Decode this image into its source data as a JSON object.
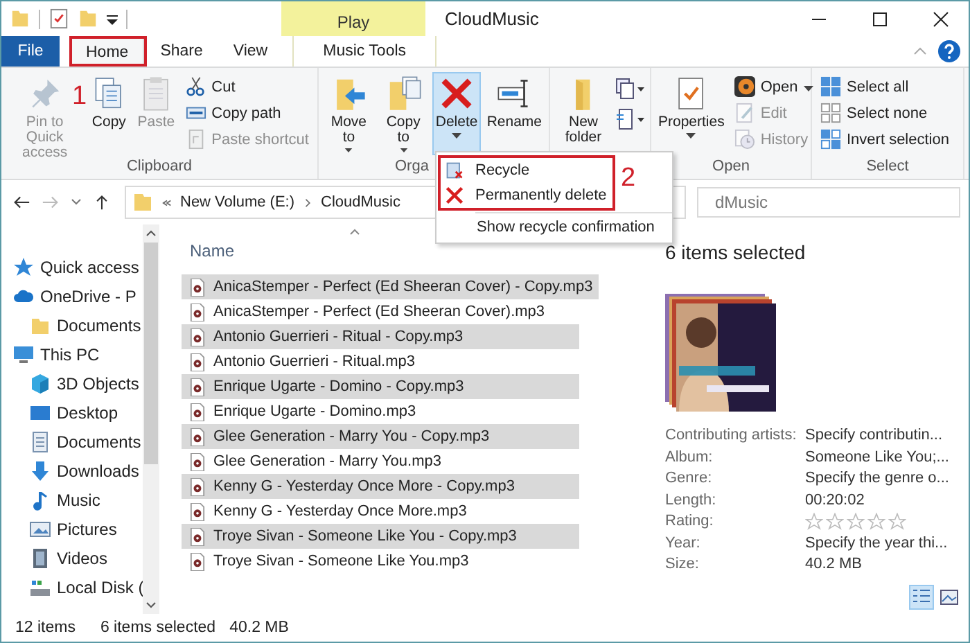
{
  "window": {
    "title": "CloudMusic",
    "contextual_group": "Play"
  },
  "tabs": [
    {
      "label": "File",
      "kind": "file",
      "selected": false
    },
    {
      "label": "Home",
      "kind": "normal",
      "selected": true
    },
    {
      "label": "Share",
      "kind": "normal",
      "selected": false
    },
    {
      "label": "View",
      "kind": "normal",
      "selected": false
    },
    {
      "label": "Music Tools",
      "kind": "contextual",
      "selected": false
    }
  ],
  "ribbon": {
    "groups": [
      {
        "label": "Clipboard",
        "items": [
          {
            "label": "Pin to Quick access",
            "disabled": true
          },
          {
            "label": "Copy",
            "disabled": false
          },
          {
            "label": "Paste",
            "disabled": true
          },
          {
            "label": "Cut",
            "disabled": false
          },
          {
            "label": "Copy path",
            "disabled": false
          },
          {
            "label": "Paste shortcut",
            "disabled": true
          }
        ]
      },
      {
        "label": "Orga",
        "items": [
          {
            "label": "Move to",
            "dropdown": true,
            "pressed": false
          },
          {
            "label": "Copy to",
            "dropdown": true,
            "pressed": false
          },
          {
            "label": "Delete",
            "dropdown": true,
            "pressed": true
          },
          {
            "label": "Rename",
            "pressed": false
          }
        ]
      },
      {
        "items": [
          {
            "label": "New folder",
            "disabled": false
          }
        ]
      },
      {
        "label": "Open",
        "items": [
          {
            "label": "Properties",
            "dropdown": true,
            "disabled": false
          },
          {
            "label": "Open",
            "dropdown": true,
            "disabled": false
          },
          {
            "label": "Edit",
            "disabled": true
          },
          {
            "label": "History",
            "disabled": true
          }
        ]
      },
      {
        "label": "Select",
        "items": [
          {
            "label": "Select all"
          },
          {
            "label": "Select none"
          },
          {
            "label": "Invert selection"
          }
        ]
      }
    ]
  },
  "annotations": [
    {
      "label": "1"
    },
    {
      "label": "2"
    }
  ],
  "delete_menu": {
    "items": [
      {
        "label": "Recycle"
      },
      {
        "label": "Permanently delete"
      },
      {
        "label": "Show recycle confirmation"
      }
    ]
  },
  "address": {
    "path": [
      "New Volume (E:)",
      "CloudMusic"
    ],
    "search_placeholder": "dMusic"
  },
  "navigation": [
    {
      "label": "Quick access",
      "kind": "star"
    },
    {
      "label": "OneDrive - P",
      "kind": "cloud",
      "children": [
        {
          "label": "Documents",
          "kind": "folder"
        }
      ]
    },
    {
      "label": "This PC",
      "kind": "pc",
      "children": [
        {
          "label": "3D Objects",
          "kind": "cube"
        },
        {
          "label": "Desktop",
          "kind": "desktop"
        },
        {
          "label": "Documents",
          "kind": "docs"
        },
        {
          "label": "Downloads",
          "kind": "download"
        },
        {
          "label": "Music",
          "kind": "music"
        },
        {
          "label": "Pictures",
          "kind": "pictures"
        },
        {
          "label": "Videos",
          "kind": "videos"
        },
        {
          "label": "Local Disk (",
          "kind": "disk"
        }
      ]
    }
  ],
  "file_list": {
    "column": "Name",
    "files": [
      {
        "name": "AnicaStemper - Perfect (Ed Sheeran Cover) - Copy.mp3",
        "selected": true
      },
      {
        "name": "AnicaStemper - Perfect (Ed Sheeran Cover).mp3",
        "selected": false
      },
      {
        "name": "Antonio Guerrieri - Ritual - Copy.mp3",
        "selected": true
      },
      {
        "name": "Antonio Guerrieri - Ritual.mp3",
        "selected": false
      },
      {
        "name": "Enrique Ugarte - Domino - Copy.mp3",
        "selected": true
      },
      {
        "name": "Enrique Ugarte - Domino.mp3",
        "selected": false
      },
      {
        "name": "Glee Generation - Marry You - Copy.mp3",
        "selected": true
      },
      {
        "name": "Glee Generation - Marry You.mp3",
        "selected": false
      },
      {
        "name": "Kenny G - Yesterday Once More - Copy.mp3",
        "selected": true
      },
      {
        "name": "Kenny G - Yesterday Once More.mp3",
        "selected": false
      },
      {
        "name": "Troye Sivan - Someone Like You - Copy.mp3",
        "selected": true
      },
      {
        "name": "Troye Sivan - Someone Like You.mp3",
        "selected": false
      }
    ]
  },
  "details": {
    "heading": "6 items selected",
    "properties": [
      {
        "label": "Contributing artists:",
        "kind": "text",
        "value": "Specify contributin..."
      },
      {
        "label": "Album:",
        "kind": "text",
        "value": "Someone Like You;..."
      },
      {
        "label": "Genre:",
        "kind": "text",
        "value": "Specify the genre o..."
      },
      {
        "label": "Length:",
        "kind": "text",
        "value": "00:20:02"
      },
      {
        "label": "Rating:",
        "kind": "rating",
        "stars": 0
      },
      {
        "label": "Year:",
        "kind": "text",
        "value": "Specify the year thi..."
      },
      {
        "label": "Size:",
        "kind": "text",
        "value": "40.2 MB"
      }
    ]
  },
  "status_bar": {
    "item_count": "12 items",
    "selection": "6 items selected",
    "size": "40.2 MB"
  }
}
